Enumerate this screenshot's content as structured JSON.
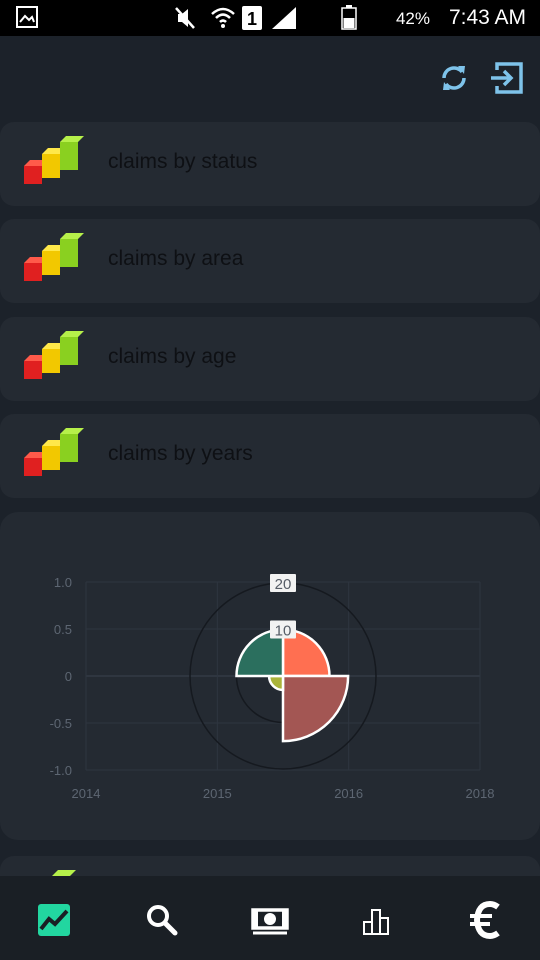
{
  "statusbar": {
    "battery": "42%",
    "time": "7:43 AM",
    "sim_slot": "1"
  },
  "appbar": {
    "icons": [
      "refresh-icon",
      "logout-icon"
    ],
    "accent": "#7ec3ea"
  },
  "menu": {
    "items": [
      {
        "label": "claims by status"
      },
      {
        "label": "claims by area"
      },
      {
        "label": "claims by age"
      },
      {
        "label": "claims by years"
      }
    ]
  },
  "chart_data": {
    "type": "polar-area",
    "x_ticks": [
      "2014",
      "2015",
      "2016",
      "2018"
    ],
    "y_ticks": [
      "1.0",
      "0.5",
      "0",
      "-0.5",
      "-1.0"
    ],
    "radial_ticks": [
      "10",
      "20"
    ],
    "slices": [
      {
        "value": 10,
        "color": "#ff6f51"
      },
      {
        "value": 14,
        "color": "#a35653"
      },
      {
        "value": 3,
        "color": "#aab43a"
      },
      {
        "value": 10,
        "color": "#2b6f5e"
      }
    ],
    "grid": true,
    "legend": "none"
  },
  "bottomnav": {
    "items": [
      "trend-chart-icon",
      "search-icon",
      "cash-icon",
      "bar-chart-icon",
      "euro-icon"
    ],
    "active": "trend-chart-icon",
    "active_color": "#22d6a0",
    "inactive_color": "#ffffff"
  }
}
